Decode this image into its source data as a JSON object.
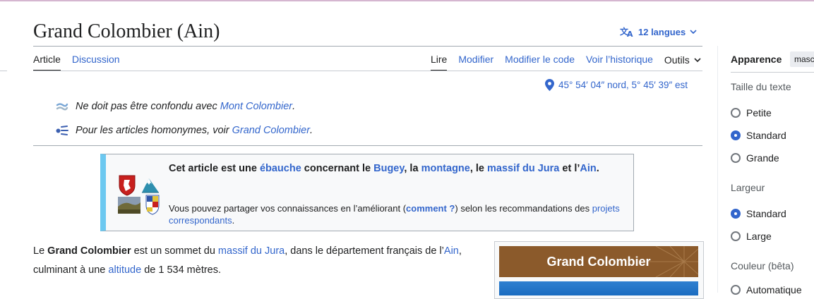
{
  "title": "Grand Colombier (Ain)",
  "languages": {
    "label": "12 langues",
    "icon": "translate-icon"
  },
  "tabs_left": [
    "Article",
    "Discussion"
  ],
  "tabs_right": [
    "Lire",
    "Modifier",
    "Modifier le code",
    "Voir l’historique",
    "Outils"
  ],
  "coordinates": {
    "text": "45° 54′ 04″ nord, 5° 45′ 39″ est",
    "icon": "map-pin-icon"
  },
  "hatnotes": [
    {
      "prefix": "Ne doit pas être confondu avec ",
      "link": "Mont Colombier",
      "suffix": ".",
      "icon": "disambiguation-icon"
    },
    {
      "prefix": "Pour les articles homonymes, voir ",
      "link": "Grand Colombier",
      "suffix": ".",
      "icon": "homonym-icon"
    }
  ],
  "stub_box": {
    "main": {
      "t1": "Cet article est une ",
      "l1": "ébauche",
      "t2": " concernant le ",
      "l2": "Bugey",
      "t3": ", la ",
      "l3": "montagne",
      "t4": ", le ",
      "l4": "massif du Jura",
      "t5": " et l’",
      "l5": "Ain",
      "t6": "."
    },
    "sub": {
      "t1": "Vous pouvez partager vos connaissances en l’améliorant (",
      "l1": "comment ?",
      "t2": ") selon les recommandations des ",
      "l2": "projets correspondants",
      "t3": "."
    }
  },
  "intro": {
    "t1": "Le ",
    "b1": "Grand Colombier",
    "t2": " est un sommet du ",
    "l1": "massif du Jura",
    "t3": ", dans le département français de l’",
    "l2": "Ain",
    "t4": ", culminant à une ",
    "l3": "altitude",
    "t5": " de 1 534 mètres."
  },
  "infobox": {
    "title": "Grand Colombier"
  },
  "sidebar": {
    "heading": "Apparence",
    "hide_button": "masc",
    "text_size": {
      "label": "Taille du texte",
      "options": [
        "Petite",
        "Standard",
        "Grande"
      ],
      "selected": "Standard"
    },
    "width": {
      "label": "Largeur",
      "options": [
        "Standard",
        "Large"
      ],
      "selected": "Standard"
    },
    "color": {
      "label": "Couleur (bêta)",
      "options": [
        "Automatique"
      ]
    }
  },
  "colors": {
    "link": "#3366cc",
    "stub_accent": "#6cc8f0",
    "infobox_header": "#8b5a2b",
    "radio_selected": "#3366cc"
  }
}
